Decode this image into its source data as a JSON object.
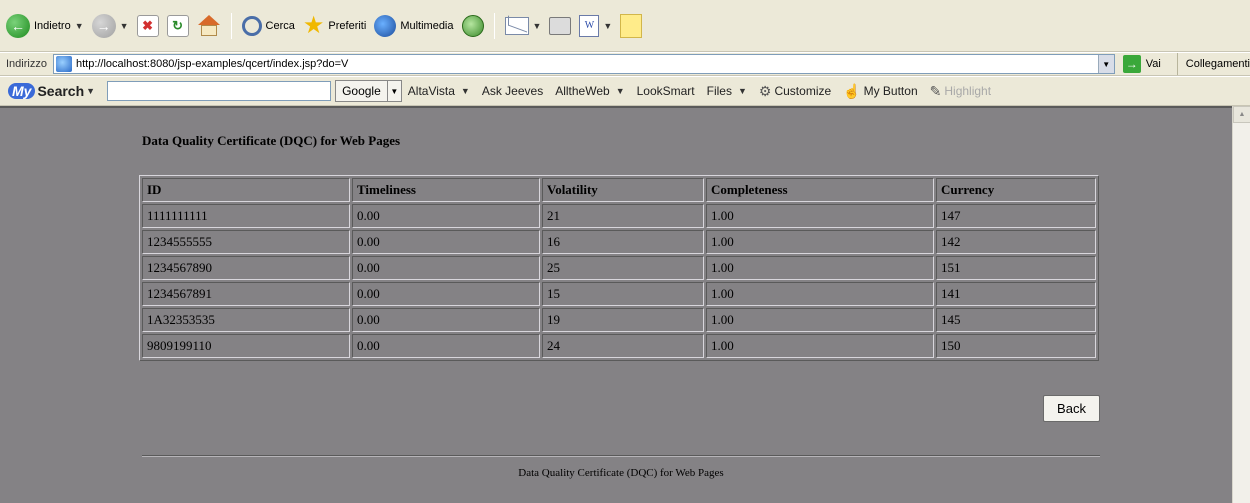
{
  "toolbar": {
    "back_label": "Indietro",
    "search_label": "Cerca",
    "favorites_label": "Preferiti",
    "media_label": "Multimedia"
  },
  "address_bar": {
    "label": "Indirizzo",
    "url": "http://localhost:8080/jsp-examples/qcert/index.jsp?do=V",
    "go_label": "Vai",
    "links_label": "Collegamenti"
  },
  "search_bar": {
    "brand_my": "My",
    "brand_search": "Search",
    "search_value": "",
    "engines": [
      "Google",
      "AltaVista",
      "Ask Jeeves",
      "AlltheWeb",
      "LookSmart",
      "Files"
    ],
    "customize_label": "Customize",
    "my_button_label": "My Button",
    "highlight_label": "Highlight"
  },
  "page": {
    "title": "Data Quality Certificate (DQC) for Web Pages",
    "back_button": "Back",
    "footer": "Data Quality Certificate (DQC) for Web Pages"
  },
  "table": {
    "columns": [
      "ID",
      "Timeliness",
      "Volatility",
      "Completeness",
      "Currency"
    ],
    "rows": [
      [
        "1111111111",
        "0.00",
        "21",
        "1.00",
        "147"
      ],
      [
        "1234555555",
        "0.00",
        "16",
        "1.00",
        "142"
      ],
      [
        "1234567890",
        "0.00",
        "25",
        "1.00",
        "151"
      ],
      [
        "1234567891",
        "0.00",
        "15",
        "1.00",
        "141"
      ],
      [
        "1A32353535",
        "0.00",
        "19",
        "1.00",
        "145"
      ],
      [
        "9809199110",
        "0.00",
        "24",
        "1.00",
        "150"
      ]
    ]
  },
  "colors": {
    "content_background": "#848285",
    "chrome_background": "#ece9d8"
  }
}
